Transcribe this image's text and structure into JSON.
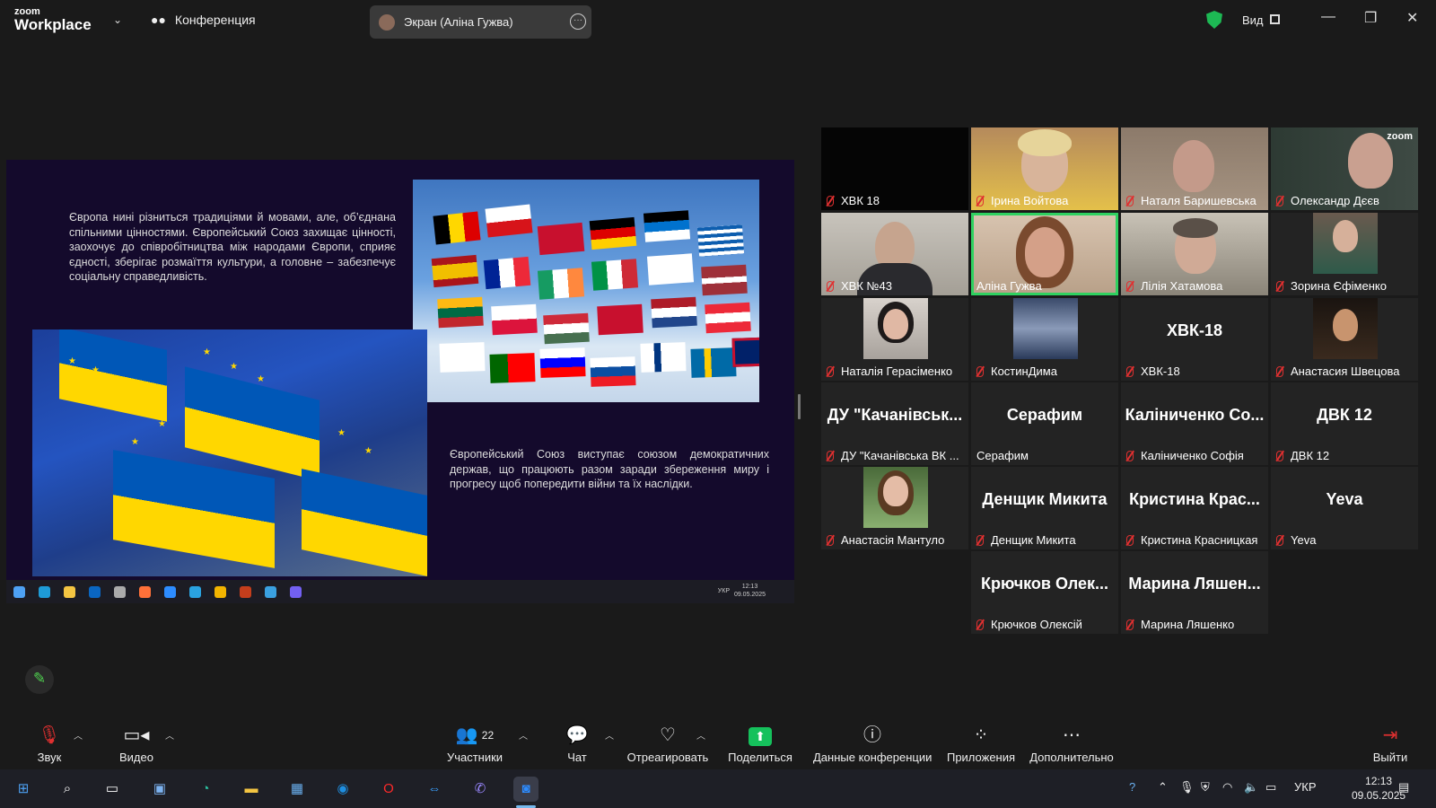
{
  "topbar": {
    "logo_line1": "zoom",
    "logo_line2": "Workplace",
    "conference_label": "Конференция",
    "screen_share_label": "Экран (Аліна Гужва)",
    "view_label": "Вид"
  },
  "shared_screen": {
    "text_top": "Європа нині різниться традиціями й мовами, але, об’єднана спільними цінностями. Європейський Союз захищає цінності, заохочує до співробітництва між народами Європи, сприяє єдності, зберігає розмаїття культури, а головне – забезпечує соціальну справедливість.",
    "text_bottom": "Європейський Союз виступає союзом демократичних держав, що працюють разом заради збереження миру і прогресу щоб попередити війни та їх наслідки.",
    "taskbar_lang": "УКР",
    "taskbar_time": "12:13",
    "taskbar_date": "09.05.2025"
  },
  "participants": [
    {
      "name": "ХВК 18",
      "big": ""
    },
    {
      "name": "Ірина Войтова",
      "big": ""
    },
    {
      "name": "Наталя Баришевська",
      "big": ""
    },
    {
      "name": "Олександр Дєєв",
      "big": ""
    },
    {
      "name": "ХВК №43",
      "big": ""
    },
    {
      "name": "Аліна Гужва",
      "big": ""
    },
    {
      "name": "Лілія Хатамова",
      "big": ""
    },
    {
      "name": "Зорина Єфіменко",
      "big": ""
    },
    {
      "name": "Наталія Герасіменко",
      "big": ""
    },
    {
      "name": "КостинДима",
      "big": ""
    },
    {
      "name": "ХВК-18",
      "big": "ХВК-18"
    },
    {
      "name": "Анастасия Швецова",
      "big": ""
    },
    {
      "name": "ДУ \"Качанівська ВК ...",
      "big": "ДУ \"Качанівськ..."
    },
    {
      "name": "Серафим",
      "big": "Серафим"
    },
    {
      "name": "Каліниченко Софія",
      "big": "Каліниченко Со..."
    },
    {
      "name": "ДВК 12",
      "big": "ДВК 12"
    },
    {
      "name": "Анастасія Мантуло",
      "big": ""
    },
    {
      "name": "Денщик Микита",
      "big": "Денщик Микита"
    },
    {
      "name": "Кристина Красницкая",
      "big": "Кристина Крас..."
    },
    {
      "name": "Yeva",
      "big": "Yeva"
    },
    {
      "name": "Крючков Олексій",
      "big": "Крючков Олек..."
    },
    {
      "name": "Марина Ляшенко",
      "big": "Марина Ляшен..."
    }
  ],
  "toolbar": {
    "audio": "Звук",
    "video": "Видео",
    "participants": "Участники",
    "participants_count": "22",
    "chat": "Чат",
    "react": "Отреагировать",
    "share": "Поделиться",
    "info": "Данные конференции",
    "apps": "Приложения",
    "more": "Дополнительно",
    "leave": "Выйти"
  },
  "windows_taskbar": {
    "lang": "УКР",
    "time": "12:13",
    "date": "09.05.2025"
  },
  "colors": {
    "zoom_green": "#15c15c",
    "active_speaker": "#2fd160",
    "muted_red": "#e03030",
    "slide_bg": "#140a2c"
  }
}
